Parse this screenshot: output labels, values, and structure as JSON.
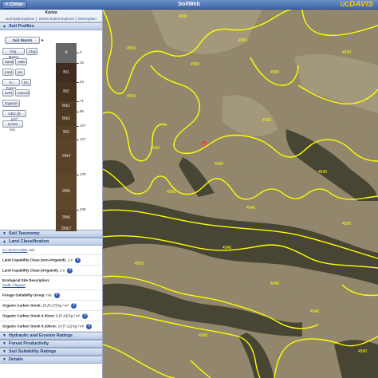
{
  "topbar": {
    "close_label": "< Close",
    "title": "SoilWeb",
    "logo_uc": "UC",
    "logo_davis": "DAVIS"
  },
  "sidebar": {
    "map_unit": "Konza",
    "links": [
      "Soil Data Explorer",
      "Series Extent Explorer",
      "Description"
    ],
    "soil_profiles_header": "Soil Profiles",
    "buttons": [
      "Soil Sketch",
      "Org. Matter",
      "Clay",
      "Sand",
      "AWC",
      "Ksat",
      "pH",
      "K-Factor",
      "EC",
      "SAR",
      "CaCO3",
      "Gypsum",
      "CEC @ pH7",
      "Linear Ext."
    ],
    "horizons": [
      {
        "name": "A",
        "top": "0",
        "color": "#5e5a55"
      },
      {
        "name": "Bt1",
        "top": "15",
        "color": "#3f2d22"
      },
      {
        "name": "Bt2",
        "top": "43",
        "color": "#46331f"
      },
      {
        "name": "Btk1",
        "top": "71",
        "color": "#4e3a23"
      },
      {
        "name": "Btk2",
        "top": "86",
        "color": "#503b23"
      },
      {
        "name": "Bt3",
        "top": "107",
        "color": "#564125"
      },
      {
        "name": "2Bt4",
        "top": "127",
        "color": "#5a4328"
      },
      {
        "name": "2Bt5",
        "top": "178",
        "color": "#5e472a"
      },
      {
        "name": "3Bt6",
        "top": "229",
        "color": "#5a4129"
      },
      {
        "name": "2Btk7",
        "top": "",
        "color": "#5b4228"
      }
    ],
    "depths": [
      "0",
      "15",
      "43",
      "71",
      "86",
      "107",
      "127",
      "178",
      "229",
      "254"
    ],
    "soil_taxonomy_header": "Soil Taxonomy",
    "land_classification_header": "Land Classification",
    "ca_storie_label": "CA Storie Index",
    "ca_storie_value": "n/a",
    "lcc_nonirr_label": "Land Capability Class (non-irrigated):",
    "lcc_nonirr_value": "2-e",
    "lcc_irr_label": "Land Capability Class (irrigated):",
    "lcc_irr_value": "2-e",
    "eco_site_label": "Ecological Site Description:",
    "eco_site_value": "Sodic Claypan",
    "forage_label": "Forage Suitability Group:",
    "forage_value": "n/a",
    "oc_stock_label": "Organic Carbon Stock:",
    "oc_stock_value": "18 [0-27] kg / m²",
    "oc_030_label": "Organic Carbon Stock 0-30cm:",
    "oc_030_value": "6 [3-10] kg / m²",
    "oc_0100_label": "Organic Carbon Stock 0-100cm:",
    "oc_0100_value": "14 [7-21] kg / m²",
    "hydraulic_header": "Hydraulic and Erosion Ratings",
    "forest_header": "Forest Productivity",
    "suitability_header": "Soil Suitability Ratings",
    "details_header": "Details",
    "help_glyph": "?"
  },
  "map": {
    "unit_labels": [
      "4540",
      "4590",
      "4590",
      "4540",
      "4540",
      "4590",
      "4590",
      "4540",
      "4540",
      "4590",
      "4540",
      "4590",
      "4540",
      "4590",
      "4590",
      "4540",
      "4590",
      "4540",
      "4590",
      "4540"
    ],
    "marker_label": "X",
    "line_color": "#ffff00",
    "marker_color": "#e33b3b"
  }
}
